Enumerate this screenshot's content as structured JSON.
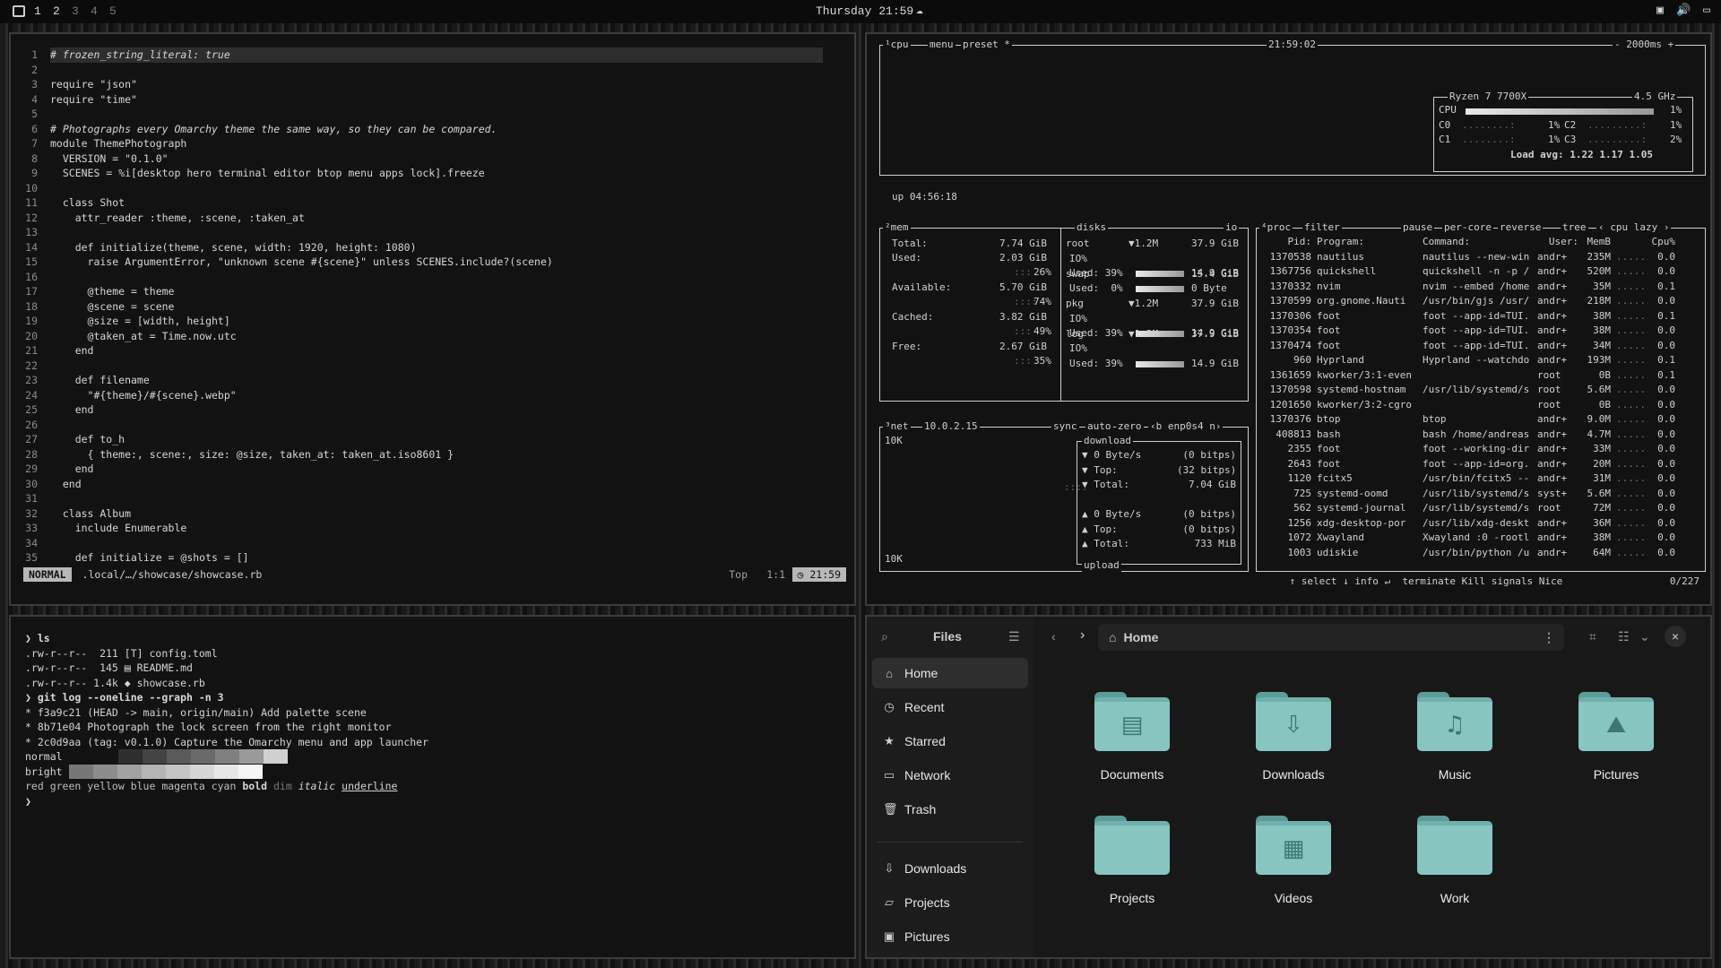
{
  "topbar": {
    "workspaces": [
      "1",
      "2",
      "3",
      "4",
      "5"
    ],
    "clock": "Thursday 21:59"
  },
  "editor": {
    "lines": [
      {
        "n": "1",
        "t": "# frozen_string_literal: true",
        "cls": "c-com",
        "cur": true
      },
      {
        "n": "2",
        "t": ""
      },
      {
        "n": "3",
        "t": "require \"json\""
      },
      {
        "n": "4",
        "t": "require \"time\""
      },
      {
        "n": "5",
        "t": ""
      },
      {
        "n": "6",
        "t": "# Photographs every Omarchy theme the same way, so they can be compared.",
        "cls": "c-com"
      },
      {
        "n": "7",
        "t": "module ThemePhotograph"
      },
      {
        "n": "8",
        "t": "  VERSION = \"0.1.0\""
      },
      {
        "n": "9",
        "t": "  SCENES = %i[desktop hero terminal editor btop menu apps lock].freeze"
      },
      {
        "n": "10",
        "t": ""
      },
      {
        "n": "11",
        "t": "  class Shot"
      },
      {
        "n": "12",
        "t": "    attr_reader :theme, :scene, :taken_at"
      },
      {
        "n": "13",
        "t": ""
      },
      {
        "n": "14",
        "t": "    def initialize(theme, scene, width: 1920, height: 1080)"
      },
      {
        "n": "15",
        "t": "      raise ArgumentError, \"unknown scene #{scene}\" unless SCENES.include?(scene)"
      },
      {
        "n": "16",
        "t": ""
      },
      {
        "n": "17",
        "t": "      @theme = theme"
      },
      {
        "n": "18",
        "t": "      @scene = scene"
      },
      {
        "n": "19",
        "t": "      @size = [width, height]"
      },
      {
        "n": "20",
        "t": "      @taken_at = Time.now.utc"
      },
      {
        "n": "21",
        "t": "    end"
      },
      {
        "n": "22",
        "t": ""
      },
      {
        "n": "23",
        "t": "    def filename"
      },
      {
        "n": "24",
        "t": "      \"#{theme}/#{scene}.webp\""
      },
      {
        "n": "25",
        "t": "    end"
      },
      {
        "n": "26",
        "t": ""
      },
      {
        "n": "27",
        "t": "    def to_h"
      },
      {
        "n": "28",
        "t": "      { theme:, scene:, size: @size, taken_at: taken_at.iso8601 }"
      },
      {
        "n": "29",
        "t": "    end"
      },
      {
        "n": "30",
        "t": "  end"
      },
      {
        "n": "31",
        "t": ""
      },
      {
        "n": "32",
        "t": "  class Album"
      },
      {
        "n": "33",
        "t": "    include Enumerable"
      },
      {
        "n": "34",
        "t": ""
      },
      {
        "n": "35",
        "t": "    def initialize = @shots = []"
      }
    ],
    "status": {
      "mode": "NORMAL",
      "path": ".local/…/showcase/showcase.rb",
      "position": "Top",
      "cursor": "1:1",
      "time": "21:59"
    }
  },
  "terminal": {
    "rows": [
      "❯ ls",
      ".rw-r--r--  211 [T] config.toml",
      ".rw-r--r--  145 ▤ README.md",
      ".rw-r--r-- 1.4k ◆ showcase.rb",
      "❯ git log --oneline --graph -n 3",
      "* f3a9c21 (HEAD -> main, origin/main) Add palette scene",
      "* 8b71e04 Photograph the lock screen from the right monitor",
      "* 2c0d9aa (tag: v0.1.0) Capture the Omarchy menu and app launcher"
    ],
    "palette_normal_label": "normal",
    "palette_bright_label": "bright",
    "palette_normal": [
      "#121212",
      "#2e2e2e",
      "#444444",
      "#5a5a5a",
      "#6a6a6a",
      "#808080",
      "#9a9a9a",
      "#d0d0d0"
    ],
    "palette_bright": [
      "#777777",
      "#8c8c8c",
      "#a2a2a2",
      "#b5b5b5",
      "#c5c5c5",
      "#d6d6d6",
      "#e6e6e6",
      "#f5f5f5"
    ],
    "styles_line": {
      "plain": "red green yellow blue magenta cyan ",
      "bold": "bold",
      "dim": "dim",
      "italic": "italic",
      "underline": "underline"
    },
    "prompt_end": "❯"
  },
  "btop": {
    "cpu": {
      "tab": "¹cpu",
      "menu": "menu",
      "preset": "preset *",
      "clock": "21:59:02",
      "interval": "- 2000ms +",
      "uptime": "up 04:56:18",
      "model": "Ryzen 7 7700X",
      "freq": "4.5 GHz",
      "rows": [
        {
          "label": "CPU",
          "pct": "1%"
        },
        {
          "label": "C0",
          "pct": "1%",
          "label2": "C2",
          "pct2": "1%"
        },
        {
          "label": "C1",
          "pct": "1%",
          "label2": "C3",
          "pct2": "2%"
        }
      ],
      "load": "Load avg: 1.22 1.17 1.05"
    },
    "mem": {
      "tab": "²mem",
      "total_label": "Total:",
      "total": "7.74 GiB",
      "used_label": "Used:",
      "used": "2.03 GiB",
      "used_pct": "26%",
      "avail_label": "Available:",
      "avail": "5.70 GiB",
      "avail_pct": "74%",
      "cached_label": "Cached:",
      "cached": "3.82 GiB",
      "cached_pct": "49%",
      "free_label": "Free:",
      "free": "2.67 GiB",
      "free_pct": "35%"
    },
    "disks": {
      "tab": "disks",
      "io": "io",
      "items": [
        {
          "name": "root",
          "io": "▼1.2M",
          "size": "37.9 GiB",
          "used_pct": "Used: 39%",
          "used_val": "14.9 GiB"
        },
        {
          "name": "swap",
          "io": "",
          "size": "15.4 GiB",
          "used_pct": "Used:  0%",
          "used_val": "0 Byte"
        },
        {
          "name": "pkg",
          "io": "▼1.2M",
          "size": "37.9 GiB",
          "used_pct": "Used: 39%",
          "used_val": "14.9 GiB"
        },
        {
          "name": "log",
          "io": "▼1.2M",
          "size": "37.9 GiB",
          "used_pct": "Used: 39%",
          "used_val": "14.9 GiB"
        }
      ]
    },
    "net": {
      "tab": "³net",
      "ip": "10.0.2.15",
      "sync": "sync",
      "auto": "auto",
      "zero": "zero",
      "iface": "‹b enp0s4 n›",
      "scale_top": "10K",
      "scale_bot": "10K",
      "download_label": "download",
      "upload_label": "upload",
      "down": [
        {
          "k": "▼ 0 Byte/s",
          "v": "(0 bitps)"
        },
        {
          "k": "▼ Top:",
          "v": "(32 bitps)"
        },
        {
          "k": "▼ Total:",
          "v": "7.04 GiB"
        }
      ],
      "up": [
        {
          "k": "▲ 0 Byte/s",
          "v": "(0 bitps)"
        },
        {
          "k": "▲ Top:",
          "v": "(0 bitps)"
        },
        {
          "k": "▲ Total:",
          "v": "733 MiB"
        }
      ]
    },
    "proc": {
      "tab": "⁴proc",
      "filter": "filter",
      "pause": "pause",
      "percore": "per-core",
      "reverse": "reverse",
      "tree": "tree",
      "sort": "‹ cpu lazy ›",
      "headers": {
        "pid": "Pid:",
        "program": "Program:",
        "command": "Command:",
        "user": "User:",
        "mem": "MemB",
        "cpu": "Cpu%"
      },
      "rows": [
        [
          "1370538",
          "nautilus",
          "nautilus --new-win",
          "andr+",
          "235M",
          "0.0"
        ],
        [
          "1367756",
          "quickshell",
          "quickshell -n -p /",
          "andr+",
          "520M",
          "0.0"
        ],
        [
          "1370332",
          "nvim",
          "nvim --embed /home",
          "andr+",
          "35M",
          "0.1"
        ],
        [
          "1370599",
          "org.gnome.Nauti",
          "/usr/bin/gjs /usr/",
          "andr+",
          "218M",
          "0.0"
        ],
        [
          "1370306",
          "foot",
          "foot --app-id=TUI.",
          "andr+",
          "38M",
          "0.1"
        ],
        [
          "1370354",
          "foot",
          "foot --app-id=TUI.",
          "andr+",
          "38M",
          "0.0"
        ],
        [
          "1370474",
          "foot",
          "foot --app-id=TUI.",
          "andr+",
          "34M",
          "0.0"
        ],
        [
          "960",
          "Hyprland",
          "Hyprland --watchdo",
          "andr+",
          "193M",
          "0.1"
        ],
        [
          "1361659",
          "kworker/3:1-even",
          "",
          "root",
          "0B",
          "0.1"
        ],
        [
          "1370598",
          "systemd-hostnam",
          "/usr/lib/systemd/s",
          "root",
          "5.6M",
          "0.0"
        ],
        [
          "1201650",
          "kworker/3:2-cgro",
          "",
          "root",
          "0B",
          "0.0"
        ],
        [
          "1370376",
          "btop",
          "btop",
          "andr+",
          "9.0M",
          "0.0"
        ],
        [
          "408813",
          "bash",
          "bash /home/andreas",
          "andr+",
          "4.7M",
          "0.0"
        ],
        [
          "2355",
          "foot",
          "foot --working-dir",
          "andr+",
          "33M",
          "0.0"
        ],
        [
          "2643",
          "foot",
          "foot --app-id=org.",
          "andr+",
          "20M",
          "0.0"
        ],
        [
          "1120",
          "fcitx5",
          "/usr/bin/fcitx5 --",
          "andr+",
          "31M",
          "0.0"
        ],
        [
          "725",
          "systemd-oomd",
          "/usr/lib/systemd/s",
          "syst+",
          "5.6M",
          "0.0"
        ],
        [
          "562",
          "systemd-journal",
          "/usr/lib/systemd/s",
          "root",
          "72M",
          "0.0"
        ],
        [
          "1256",
          "xdg-desktop-por",
          "/usr/lib/xdg-deskt",
          "andr+",
          "36M",
          "0.0"
        ],
        [
          "1072",
          "Xwayland",
          "Xwayland :0 -rootl",
          "andr+",
          "38M",
          "0.0"
        ],
        [
          "1003",
          "udiskie",
          "/usr/bin/python /u",
          "andr+",
          "64M",
          "0.0"
        ]
      ],
      "footer": {
        "select": "↑ select ↓",
        "info": "info ↵",
        "terminate": "terminate",
        "kill": "Kill",
        "signals": "signals",
        "nice": "Nice",
        "count": "0/227"
      }
    }
  },
  "files": {
    "title": "Files",
    "location": "Home",
    "sidebar": [
      {
        "label": "Home",
        "icon": "⌂",
        "active": true
      },
      {
        "label": "Recent",
        "icon": "◷"
      },
      {
        "label": "Starred",
        "icon": "★"
      },
      {
        "label": "Network",
        "icon": "▭"
      },
      {
        "label": "Trash",
        "icon": "🗑"
      },
      {
        "label": "Downloads",
        "icon": "⇩"
      },
      {
        "label": "Projects",
        "icon": "▱"
      },
      {
        "label": "Pictures",
        "icon": "▣"
      }
    ],
    "folders": [
      {
        "name": "Documents",
        "glyph": "▤"
      },
      {
        "name": "Downloads",
        "glyph": "⇩"
      },
      {
        "name": "Music",
        "glyph": "♫"
      },
      {
        "name": "Pictures",
        "glyph": "⛰"
      },
      {
        "name": "Projects",
        "glyph": ""
      },
      {
        "name": "Videos",
        "glyph": "▦"
      },
      {
        "name": "Work",
        "glyph": ""
      }
    ]
  }
}
